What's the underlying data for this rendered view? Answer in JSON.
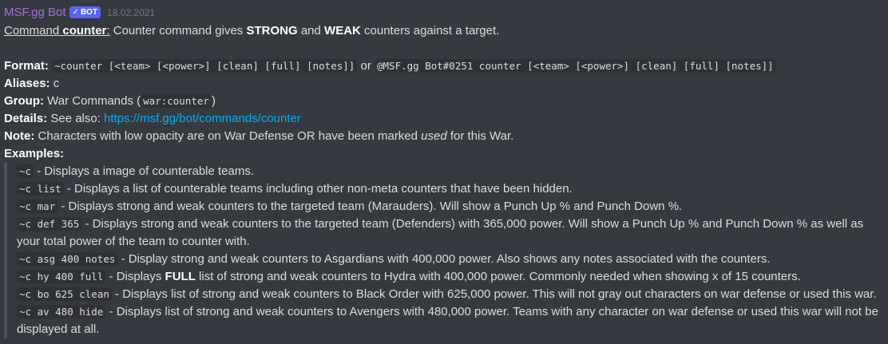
{
  "header": {
    "author": "MSF.gg Bot",
    "bot_tag": "BOT",
    "timestamp": "18.02.2021"
  },
  "intro": {
    "command_label": "Command",
    "command_name": "counter",
    "colon": ":",
    "desc_1": " Counter command gives ",
    "strong": "STRONG",
    "and": " and ",
    "weak": "WEAK",
    "desc_2": " counters against a target."
  },
  "format": {
    "label": "Format:",
    "code_1": "~counter [<team> [<power>] [clean] [full] [notes]]",
    "or": " or ",
    "code_2": "@MSF.gg Bot#0251 counter [<team> [<power>] [clean] [full] [notes]]"
  },
  "aliases": {
    "label": "Aliases:",
    "value": "c"
  },
  "group": {
    "label": "Group:",
    "value": "War Commands (",
    "code": "war:counter",
    "close": ")"
  },
  "details": {
    "label": "Details:",
    "see_also": "See also: ",
    "link": "https://msf.gg/bot/commands/counter"
  },
  "note": {
    "label": "Note:",
    "text_1": "Characters with low opacity are on War Defense OR have been marked ",
    "used": "used",
    "text_2": " for this War."
  },
  "examples": {
    "label": "Examples:",
    "items": [
      {
        "code": "~c",
        "text": " - Displays a image of counterable teams."
      },
      {
        "code": "~c list",
        "text": " - Displays a list of counterable teams including other non-meta counters that have been hidden."
      },
      {
        "code": "~c mar",
        "text": " - Displays strong and weak counters to the targeted team (Marauders). Will show a Punch Up % and Punch Down %."
      },
      {
        "code": "~c def 365",
        "text": " - Displays strong and weak counters to the targeted team (Defenders) with 365,000 power. Will show a Punch Up % and Punch Down % as well as your total power of the team to counter with."
      },
      {
        "code": "~c asg 400 notes",
        "text": " - Display strong and weak counters to Asgardians with 400,000 power. Also shows any notes associated with the counters."
      },
      {
        "code": "~c hy 400 full",
        "text_a": " - Displays ",
        "bold": "FULL",
        "text_b": " list of strong and weak counters to Hydra with 400,000 power. Commonly needed when showing x of 15 counters."
      },
      {
        "code": "~c bo 625 clean",
        "text": " - Displays list of strong and weak counters to Black Order with 625,000 power. This will not gray out characters on war defense or used this war."
      },
      {
        "code": "~c av 480 hide",
        "text": " - Displays list of strong and weak counters to Avengers with 480,000 power. Teams with any character on war defense or used this war will not be displayed at all."
      }
    ]
  },
  "colors": {
    "background": "#36393f",
    "author": "#a56fd6",
    "bot_tag": "#5865f2",
    "link": "#00aff4",
    "text": "#dcddde",
    "quote_bar": "#4f545c"
  }
}
